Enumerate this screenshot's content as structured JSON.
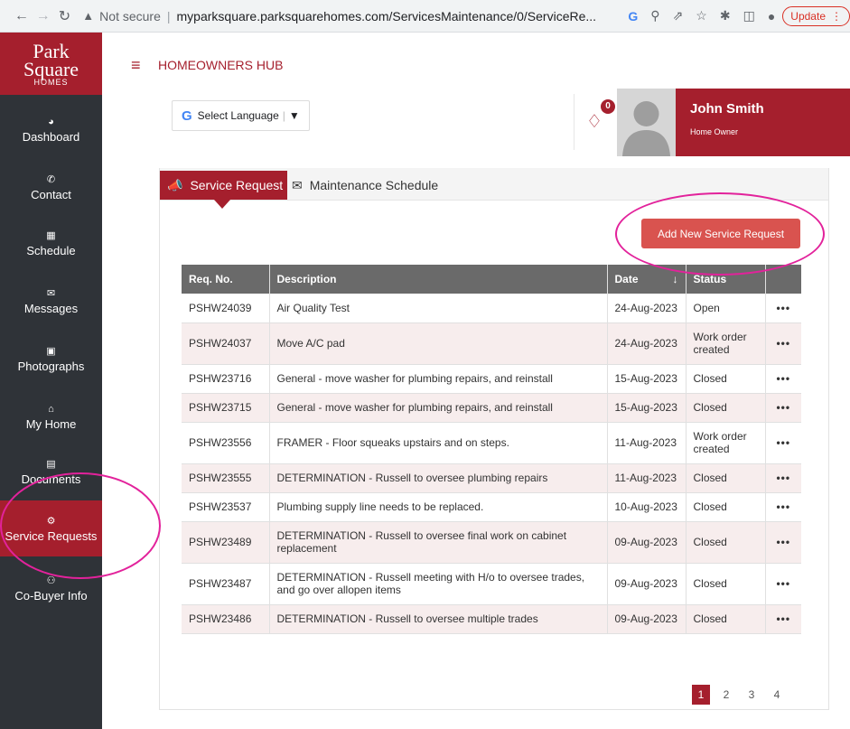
{
  "browser": {
    "not_secure": "Not secure",
    "url": "myparksquare.parksquarehomes.com/ServicesMaintenance/0/ServiceRe...",
    "update_label": "Update"
  },
  "logo": {
    "line1": "Park",
    "line2": "Square",
    "line3": "HOMES"
  },
  "sidebar": {
    "items": [
      {
        "label": "Dashboard",
        "icon": "dashboard-icon"
      },
      {
        "label": "Contact",
        "icon": "phone-icon"
      },
      {
        "label": "Schedule",
        "icon": "calendar-icon"
      },
      {
        "label": "Messages",
        "icon": "envelope-icon"
      },
      {
        "label": "Photographs",
        "icon": "image-icon"
      },
      {
        "label": "My Home",
        "icon": "home-icon"
      },
      {
        "label": "Documents",
        "icon": "document-icon"
      },
      {
        "label": "Service Requests",
        "icon": "gears-icon",
        "active": true
      },
      {
        "label": "Co-Buyer Info",
        "icon": "users-icon"
      }
    ]
  },
  "header": {
    "title": "HOMEOWNERS HUB",
    "language": "Select Language",
    "notification_count": "0",
    "user_name": "John Smith",
    "user_role": "Home Owner"
  },
  "tabs": {
    "service_request": "Service Request",
    "maintenance_schedule": "Maintenance Schedule"
  },
  "add_button": "Add New Service Request",
  "table": {
    "headers": {
      "req_no": "Req. No.",
      "description": "Description",
      "date": "Date",
      "status": "Status"
    },
    "rows": [
      {
        "req": "PSHW24039",
        "desc": "Air Quality Test",
        "date": "24-Aug-2023",
        "status": "Open"
      },
      {
        "req": "PSHW24037",
        "desc": "Move A/C pad",
        "date": "24-Aug-2023",
        "status": "Work order created"
      },
      {
        "req": "PSHW23716",
        "desc": "General - move washer for plumbing repairs, and reinstall",
        "date": "15-Aug-2023",
        "status": "Closed"
      },
      {
        "req": "PSHW23715",
        "desc": "General - move washer for plumbing repairs, and reinstall",
        "date": "15-Aug-2023",
        "status": "Closed"
      },
      {
        "req": "PSHW23556",
        "desc": "FRAMER - Floor squeaks upstairs and on steps.",
        "date": "11-Aug-2023",
        "status": "Work order created"
      },
      {
        "req": "PSHW23555",
        "desc": "DETERMINATION - Russell to oversee plumbing repairs",
        "date": "11-Aug-2023",
        "status": "Closed"
      },
      {
        "req": "PSHW23537",
        "desc": "Plumbing supply line needs to be replaced.",
        "date": "10-Aug-2023",
        "status": "Closed"
      },
      {
        "req": "PSHW23489",
        "desc": "DETERMINATION - Russell to oversee final work on cabinet replacement",
        "date": "09-Aug-2023",
        "status": "Closed"
      },
      {
        "req": "PSHW23487",
        "desc": "DETERMINATION - Russell meeting with H/o to oversee trades, and go over allopen items",
        "date": "09-Aug-2023",
        "status": "Closed"
      },
      {
        "req": "PSHW23486",
        "desc": "DETERMINATION - Russell to oversee multiple trades",
        "date": "09-Aug-2023",
        "status": "Closed"
      }
    ],
    "more": "•••"
  },
  "pagination": [
    "1",
    "2",
    "3",
    "4"
  ],
  "colors": {
    "brand": "#a51f2d",
    "sidebar": "#2f3338",
    "button": "#d9534f",
    "annotation": "#e2229b"
  }
}
